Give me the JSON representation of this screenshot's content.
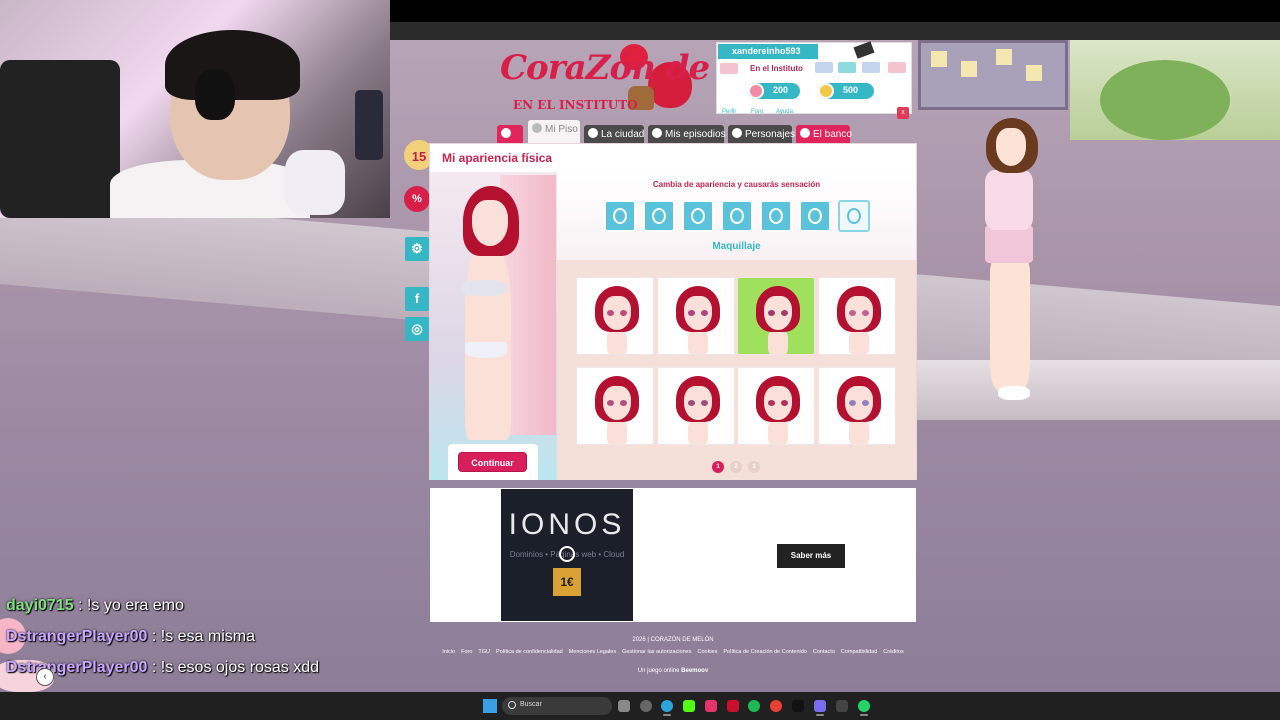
{
  "game": {
    "logo_title": "CoraZón de melón",
    "logo_subtitle": "EN EL INSTITUTO"
  },
  "user": {
    "username": "xandereinho593",
    "status": "En el Instituto",
    "hearts": "200",
    "coins": "500",
    "links": [
      "Perfil",
      "Foro",
      "Ayuda"
    ]
  },
  "nav": {
    "tabs": [
      "Mi Piso",
      "La ciudad",
      "Mis episodios",
      "Personajes",
      "El banco"
    ]
  },
  "side": {
    "badge_number": "15",
    "discount_icon": "%",
    "settings_icon": "gear-icon",
    "facebook_label": "f",
    "instagram_icon": "instagram-icon"
  },
  "modal": {
    "title": "Mi apariencia física",
    "subtitle": "Cambia de apariencia y causarás sensación",
    "category_label": "Maquillaje",
    "continue_label": "Continuar",
    "close_label": "x",
    "category_icons": [
      "hair-icon",
      "face-icon",
      "eyes-icon",
      "mouth-icon",
      "skin-icon",
      "eyebrows-icon",
      "makeup-icon"
    ],
    "active_category_index": 6,
    "selected_item_index": 2,
    "items_count": 8,
    "pages": [
      "1",
      "2",
      "3"
    ],
    "current_page": 0
  },
  "ad": {
    "brand": "IONOS",
    "tagline": "Dominios • Páginas web • Cloud",
    "price": "1€",
    "button_label": "Saber más"
  },
  "footer": {
    "copyright": "2026 | CORAZÓN DE MELÓN",
    "links": [
      "Inicio",
      "Foro",
      "TGU",
      "Política de confidencialidad",
      "Menciones Legales",
      "Gestionar las autorizaciones",
      "Cookies",
      "Política de Creación de Contenido",
      "Contacto",
      "Compatibilidad",
      "Créditos"
    ],
    "made_by": "Un juego online",
    "company": "Beemoov"
  },
  "chat": [
    {
      "user": "dayi0715",
      "color": "#7fe07f",
      "message": ": !s yo era emo"
    },
    {
      "user": "DstrangerPlayer00",
      "color": "#c9a6ff",
      "message": ": !s esa misma"
    },
    {
      "user": "DstrangerPlayer00",
      "color": "#c9a6ff",
      "message": ": !s esos ojos rosas xdd"
    }
  ],
  "taskbar": {
    "search_placeholder": "Buscar"
  },
  "colors": {
    "brand_pink": "#d81f4a",
    "brand_cyan": "#35b7c5",
    "selected_item": "#9fe05c"
  }
}
